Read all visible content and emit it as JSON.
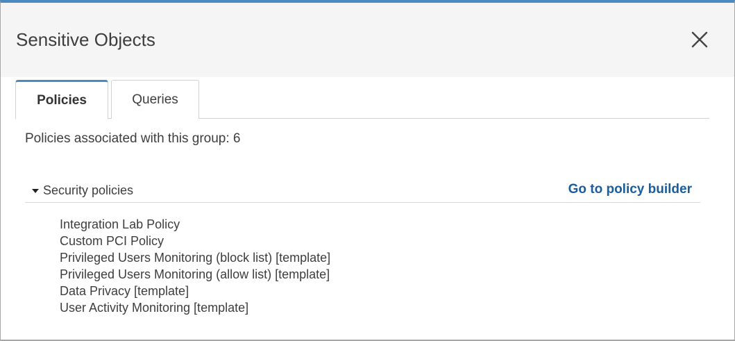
{
  "dialog": {
    "title": "Sensitive Objects",
    "accent_color": "#4b89c1"
  },
  "icons": {
    "close": "close-icon",
    "section_caret": "caret-down-icon"
  },
  "tabs": [
    {
      "label": "Policies",
      "active": true
    },
    {
      "label": "Queries",
      "active": false
    }
  ],
  "summary": {
    "text": "Policies associated with this group: 6"
  },
  "section": {
    "label": "Security policies",
    "expanded": true,
    "link_label": "Go to policy builder",
    "link_color": "#1a5d9b"
  },
  "policies": [
    "Integration Lab Policy",
    "Custom PCI Policy",
    "Privileged Users Monitoring (block list) [template]",
    "Privileged Users Monitoring (allow list) [template]",
    "Data Privacy [template]",
    "User Activity Monitoring [template]"
  ]
}
